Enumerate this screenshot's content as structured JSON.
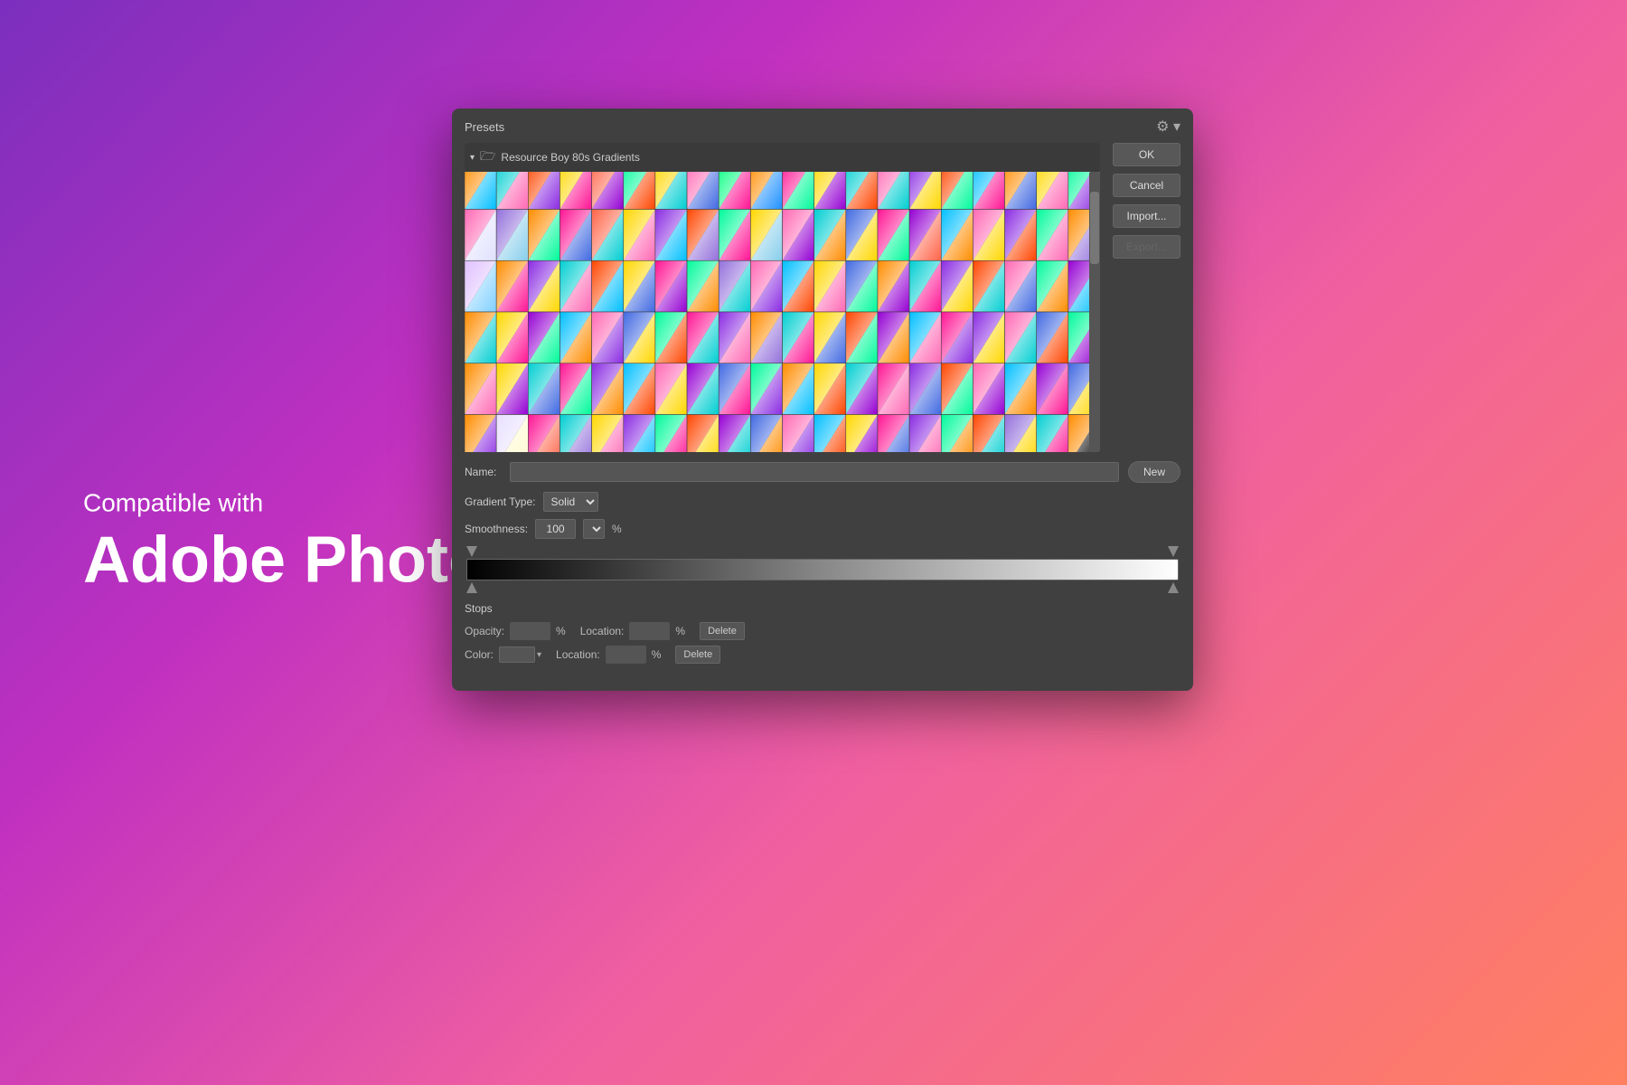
{
  "background": {
    "gradient": "linear-gradient(135deg, #7B2FBE 0%, #C030C0 30%, #F060A0 60%, #FF8060 100%)"
  },
  "left_text": {
    "compatible_label": "Compatible with",
    "app_name": "Adobe Photoshop"
  },
  "dialog": {
    "title": "Presets",
    "folder_name": "Resource Boy 80s Gradients",
    "buttons": {
      "ok": "OK",
      "cancel": "Cancel",
      "import": "Import...",
      "export": "Export...",
      "new": "New"
    },
    "name_label": "Name:",
    "name_value": "",
    "gradient_type_label": "Gradient Type:",
    "gradient_type_value": "Solid",
    "smoothness_label": "Smoothness:",
    "smoothness_value": "100",
    "percent": "%",
    "stops_title": "Stops",
    "opacity_label": "Opacity:",
    "location_label": "Location:",
    "location_label2": "Location:",
    "delete_label": "Delete",
    "delete_label2": "Delete",
    "color_label": "Color:"
  },
  "gradient_swatches": [
    [
      "#FF8C00,#00BFFF",
      "#00CED1,#FF69B4",
      "#FF4500,#8A2BE2",
      "#FFD700,#FF1493",
      "#FF6347,#9400D3",
      "#00FA9A,#FF4500",
      "#FFD700,#00CED1",
      "#FF69B4,#4169E1",
      "#00FF7F,#FF1493",
      "#FF8C00,#1E90FF",
      "#FF1493,#00FA9A",
      "#FFD700,#9400D3",
      "#00CED1,#FF4500",
      "#FF69B4,#00CED1",
      "#8A2BE2,#FFD700",
      "#FF4500,#00FA9A",
      "#00BFFF,#FF1493",
      "#FF8C00,#4169E1",
      "#FFD700,#FF69B4",
      "#00FA9A,#8A2BE2"
    ],
    [
      "#FF69B4,#E0E0FF",
      "#9370DB,#87CEEB",
      "#FF8C00,#00FA9A",
      "#FF1493,#4169E1",
      "#FF6347,#00CED1",
      "#FFD700,#FF69B4",
      "#8A2BE2,#00BFFF",
      "#FF4500,#9370DB",
      "#00FA9A,#FF1493",
      "#FFD700,#87CEEB",
      "#FF69B4,#9400D3",
      "#00CED1,#FF8C00",
      "#4169E1,#FFD700",
      "#FF1493,#00FA9A",
      "#9400D3,#FF6347",
      "#00BFFF,#FF8C00",
      "#FF69B4,#FFD700",
      "#8A2BE2,#FF4500",
      "#00FA9A,#FF69B4",
      "#FF8C00,#9370DB"
    ],
    [
      "#E0C0FF,#80D0FF",
      "#FF8C00,#FF1493",
      "#8A2BE2,#FFD700",
      "#00CED1,#FF69B4",
      "#FF4500,#00BFFF",
      "#FFD700,#4169E1",
      "#FF1493,#9400D3",
      "#00FA9A,#FF8C00",
      "#9370DB,#00CED1",
      "#FF69B4,#8A2BE2",
      "#00BFFF,#FF4500",
      "#FFD700,#FF69B4",
      "#4169E1,#00FA9A",
      "#FF8C00,#9400D3",
      "#00CED1,#FF1493",
      "#8A2BE2,#FFD700",
      "#FF4500,#00CED1",
      "#FF69B4,#4169E1",
      "#00FA9A,#FF8C00",
      "#9400D3,#00BFFF"
    ],
    [
      "#FF8C00,#00CED1",
      "#FFD700,#FF1493",
      "#9400D3,#00FA9A",
      "#00BFFF,#FF8C00",
      "#FF69B4,#8A2BE2",
      "#4169E1,#FFD700",
      "#00FA9A,#FF4500",
      "#FF1493,#00CED1",
      "#8A2BE2,#FF69B4",
      "#FF8C00,#9370DB",
      "#00CED1,#FF1493",
      "#FFD700,#4169E1",
      "#FF4500,#00FA9A",
      "#9400D3,#FF8C00",
      "#00BFFF,#FF69B4",
      "#FF1493,#8A2BE2",
      "#8A2BE2,#FFD700",
      "#FF69B4,#00CED1",
      "#4169E1,#FF4500",
      "#00FA9A,#9400D3"
    ],
    [
      "#FF8C00,#FF69B4",
      "#FFD700,#9400D3",
      "#00CED1,#4169E1",
      "#FF1493,#00FA9A",
      "#8A2BE2,#FF8C00",
      "#00BFFF,#FF4500",
      "#FF69B4,#FFD700",
      "#9400D3,#00CED1",
      "#4169E1,#FF1493",
      "#00FA9A,#8A2BE2",
      "#FF8C00,#00BFFF",
      "#FFD700,#FF4500",
      "#00CED1,#9400D3",
      "#FF1493,#FF69B4",
      "#8A2BE2,#4169E1",
      "#FF4500,#00FA9A",
      "#FF69B4,#9400D3",
      "#00BFFF,#FF8C00",
      "#9400D3,#FF1493",
      "#4169E1,#FFD700"
    ],
    [
      "#FF8C00,#8A2BE2",
      "#E8E0FF,#FFFACD",
      "#FF1493,#FF6347",
      "#00CED1,#9370DB",
      "#FFD700,#FF69B4",
      "#8A2BE2,#00BFFF",
      "#00FA9A,#FF1493",
      "#FF4500,#FFD700",
      "#9400D3,#00CED1",
      "#4169E1,#FF8C00",
      "#FF69B4,#8A2BE2",
      "#00BFFF,#FF4500",
      "#FFD700,#9400D3",
      "#FF1493,#4169E1",
      "#8A2BE2,#FF69B4",
      "#00FA9A,#FF8C00",
      "#FF4500,#00CED1",
      "#9370DB,#FFD700",
      "#00CED1,#FF1493",
      "#FF8C00,#000000"
    ]
  ]
}
